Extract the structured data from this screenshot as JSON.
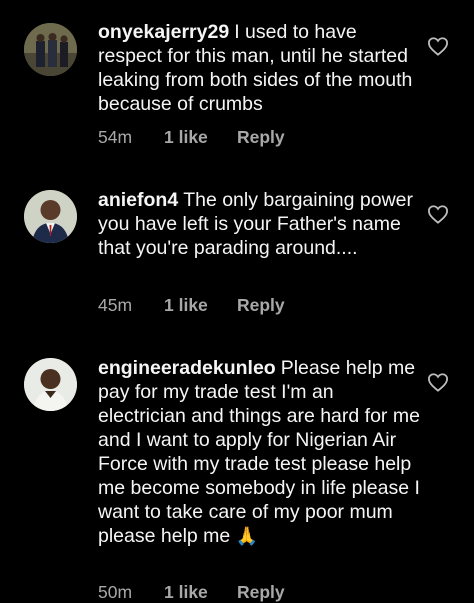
{
  "comments": [
    {
      "username": "onyekajerry29",
      "text": "I used to have respect for this man, until he started leaking from both sides of the mouth because of crumbs",
      "time": "54m",
      "likes": "1 like",
      "reply": "Reply"
    },
    {
      "username": "aniefon4",
      "text": "The only bargaining power you have left is your Father's name that you're parading around....",
      "time": "45m",
      "likes": "1 like",
      "reply": "Reply"
    },
    {
      "username": "engineeradekunleo",
      "text": "Please help me pay for my trade test I'm an electrician and things are hard for me and I want to apply for Nigerian Air Force with my trade test please help me become somebody in life please I want to take care of my poor mum please help me",
      "emoji": "🙏",
      "time": "50m",
      "likes": "1 like",
      "reply": "Reply"
    }
  ],
  "icons": {
    "like": "heart-outline-icon"
  }
}
